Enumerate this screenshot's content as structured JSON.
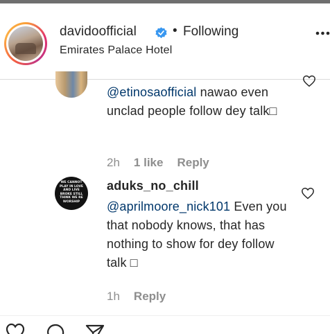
{
  "header": {
    "username": "davidoofficial",
    "separator": "•",
    "follow_status": "Following",
    "location": "Emirates Palace Hotel"
  },
  "comments": [
    {
      "username": "",
      "mention": "@etinosaofficial",
      "text": " nawao even unclad people follow dey talk□",
      "time": "2h",
      "likes": "1 like",
      "reply": "Reply"
    },
    {
      "username": "aduks_no_chill",
      "mention": "@aprilmoore_nick101",
      "text": " Even you that nobody knows, that has nothing to show for dey follow talk □",
      "time": "1h",
      "reply": "Reply",
      "avatar_text": "WE CANNOT PLAY IN LOVE AND LIVE BROKE STILL THINK WE RE WORSHIP"
    }
  ],
  "icons": {
    "verified": "verified-badge-icon",
    "more": "more-options-icon",
    "like": "heart-icon",
    "comment": "comment-icon",
    "share": "share-icon"
  },
  "colors": {
    "verified_blue": "#3897f0",
    "mention_blue": "#00376b",
    "meta_gray": "#8e8e8e"
  }
}
